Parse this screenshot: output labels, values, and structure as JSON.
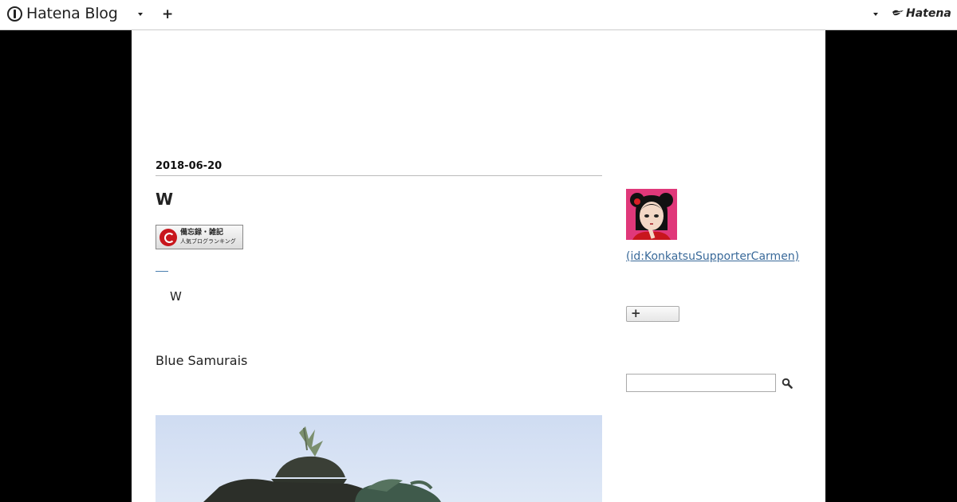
{
  "header": {
    "logo_text": "Hatena Blog",
    "brand_text": "Hatena",
    "add_label": "+"
  },
  "entry": {
    "date": "2018-06-20",
    "title": "W",
    "ranking_banner": {
      "line1": "備忘録・雑記",
      "line2": "人気ブログランキング"
    },
    "paragraph_1": "W",
    "paragraph_2": "Blue Samurais"
  },
  "sidebar": {
    "profile_id": "(id:KonkatsuSupporterCarmen)",
    "follow_label": "+",
    "search_placeholder": ""
  },
  "colors": {
    "background": "#000000",
    "link": "#3a6a9a",
    "avatar_bg": "#e0387a"
  }
}
